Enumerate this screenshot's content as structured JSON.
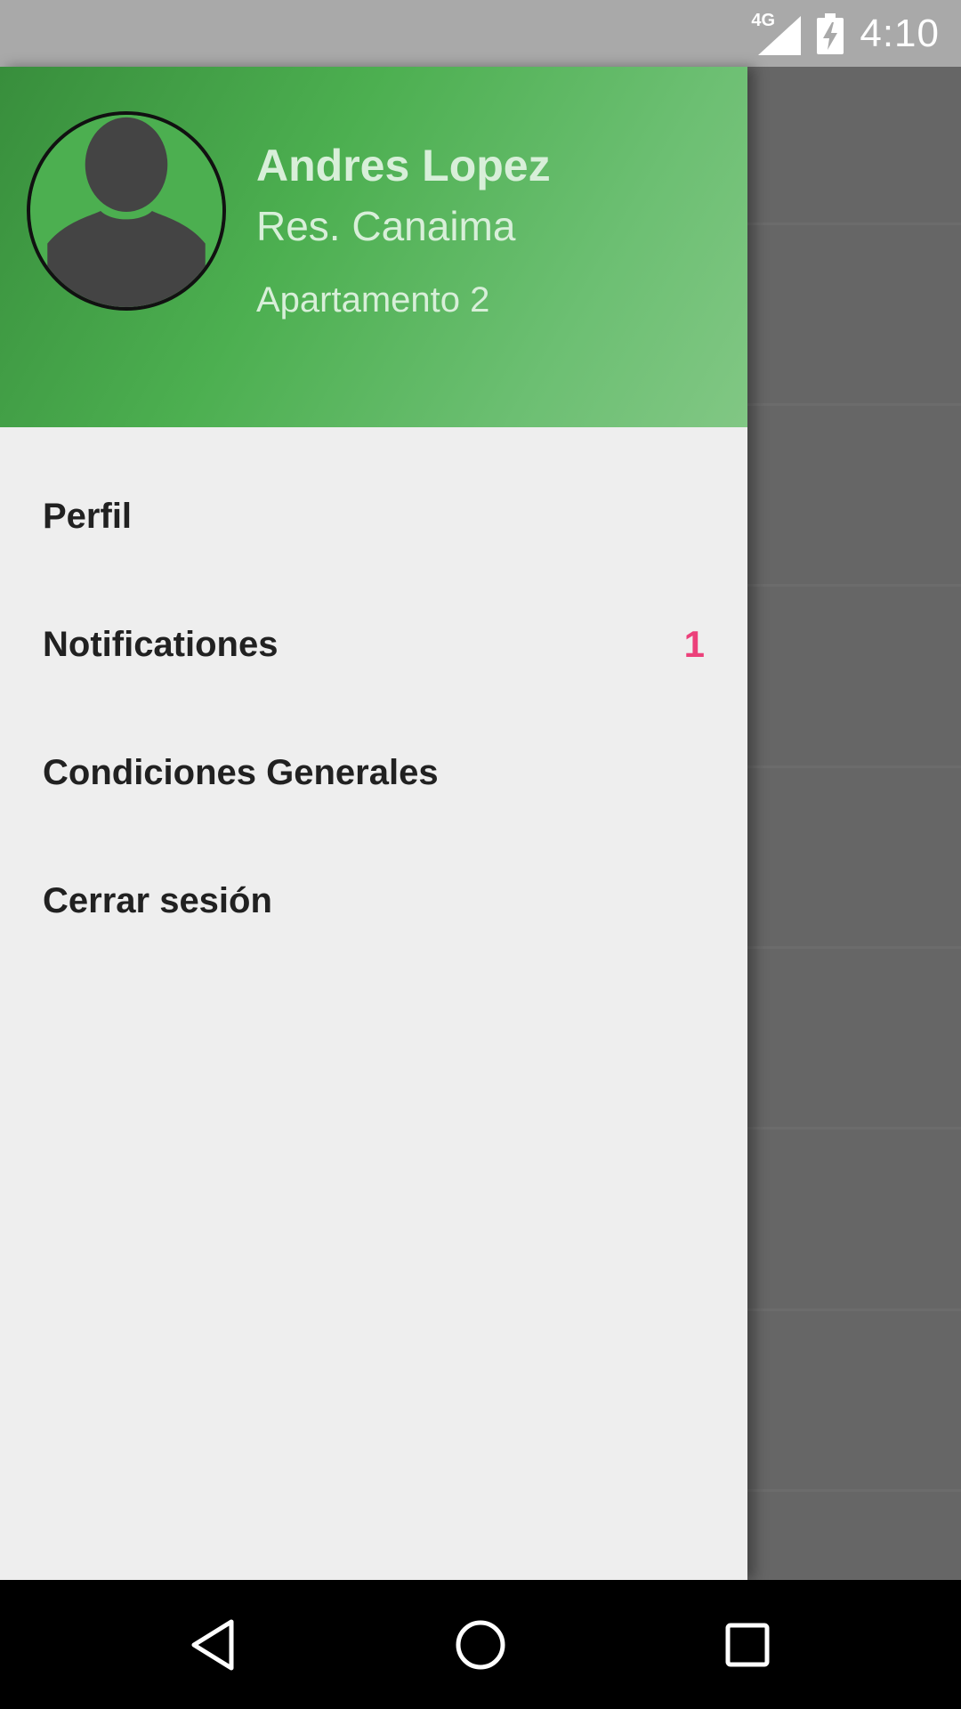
{
  "status_bar": {
    "network": "4G",
    "time": "4:10",
    "icons": [
      "signal-icon",
      "battery-charging-icon"
    ]
  },
  "drawer": {
    "header": {
      "name": "Andres Lopez",
      "residence": "Res. Canaima",
      "apartment": "Apartamento 2",
      "avatar": "default-user-avatar-icon",
      "gradient_colors": [
        "#388e3c",
        "#4caf50",
        "#81c784"
      ]
    },
    "menu": [
      {
        "label": "Perfil"
      },
      {
        "label": "Notificationes",
        "badge": "1"
      },
      {
        "label": "Condiciones Generales"
      },
      {
        "label": "Cerrar sesión"
      }
    ]
  },
  "nav_bar": {
    "icons": [
      "back-icon",
      "home-icon",
      "recents-icon"
    ]
  },
  "colors": {
    "accent": "#ec407a",
    "primary": "#4caf50",
    "drawer_background": "#eeeeee",
    "scrim": "#666666"
  }
}
